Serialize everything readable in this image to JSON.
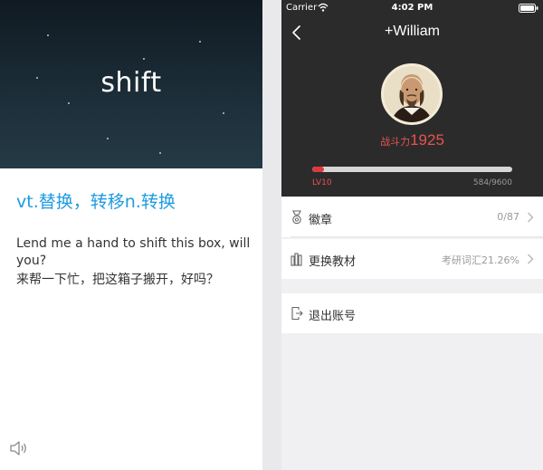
{
  "left": {
    "word": "shift",
    "meaning": "vt.替换，转移n.转换",
    "example_en": "Lend me a hand to shift this box, will you?",
    "example_cn": "来帮一下忙，把这箱子搬开，好吗？",
    "speaker_icon": "speaker-icon",
    "colors": {
      "hero_bg": "#172631",
      "meaning": "#1f9be0"
    }
  },
  "right": {
    "status": {
      "carrier": "Carrier",
      "time": "4:02 PM"
    },
    "title": "+William",
    "power": {
      "label": "战斗力",
      "value": "1925"
    },
    "level": "LV10",
    "exp": "584/9600",
    "exp_progress": 0.0608,
    "menu": [
      {
        "label": "徽章",
        "value": "0/87",
        "icon": "medal-icon"
      },
      {
        "label": "更换教材",
        "value": "考研词汇21.26%",
        "icon": "books-icon"
      }
    ],
    "logout": {
      "label": "退出账号",
      "icon": "exit-icon"
    },
    "colors": {
      "header_bg": "#2b2b2b",
      "accent": "#e8534d",
      "bar": "#e0383c"
    }
  }
}
